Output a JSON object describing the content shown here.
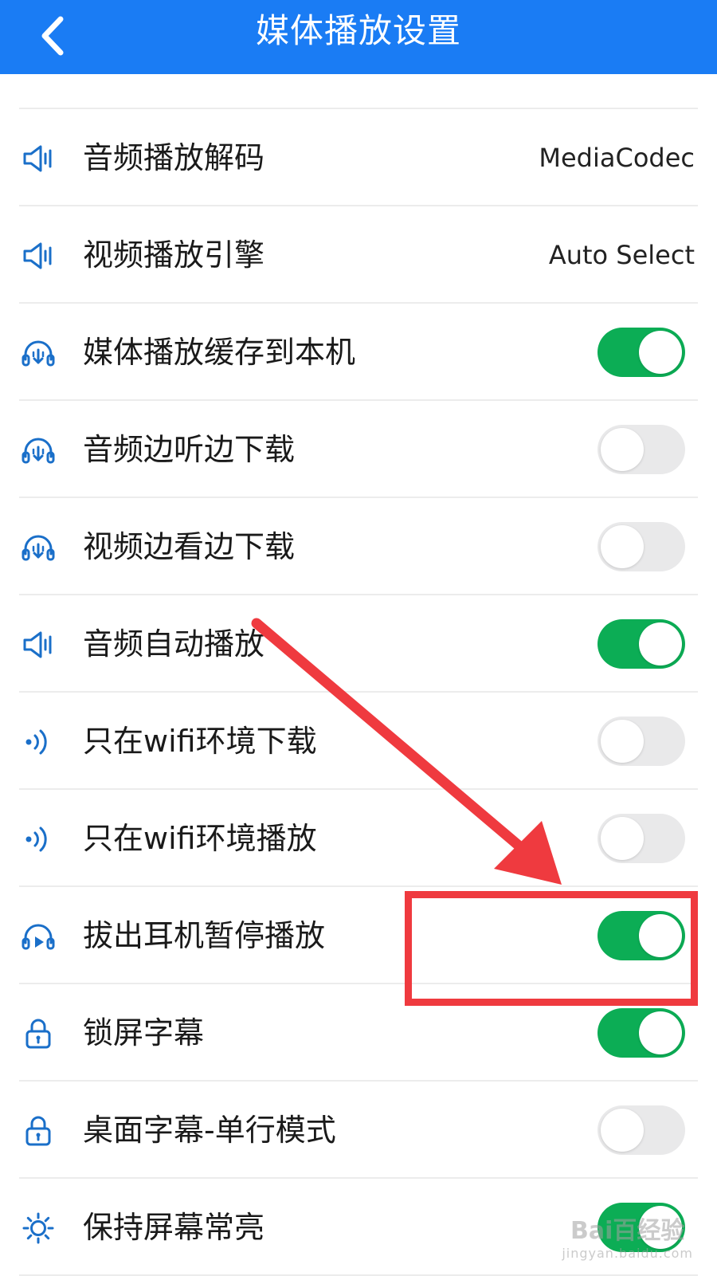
{
  "header": {
    "title": "媒体播放设置",
    "back_icon": "chevron-left-icon",
    "background_color": "#1a7cf4"
  },
  "settings": [
    {
      "label": "音频播放解码",
      "icon": "speaker-icon",
      "type": "value",
      "value": "MediaCodec"
    },
    {
      "label": "视频播放引擎",
      "icon": "speaker-icon",
      "type": "value",
      "value": "Auto Select"
    },
    {
      "label": "媒体播放缓存到本机",
      "icon": "headphones-download-icon",
      "type": "toggle",
      "on": true
    },
    {
      "label": "音频边听边下载",
      "icon": "headphones-download-icon",
      "type": "toggle",
      "on": false
    },
    {
      "label": "视频边看边下载",
      "icon": "headphones-download-icon",
      "type": "toggle",
      "on": false
    },
    {
      "label": "音频自动播放",
      "icon": "speaker-icon",
      "type": "toggle",
      "on": true
    },
    {
      "label": "只在wifi环境下载",
      "icon": "signal-waves-icon",
      "type": "toggle",
      "on": false
    },
    {
      "label": "只在wifi环境播放",
      "icon": "signal-waves-icon",
      "type": "toggle",
      "on": false
    },
    {
      "label": "拔出耳机暂停播放",
      "icon": "headphones-play-icon",
      "type": "toggle",
      "on": true
    },
    {
      "label": "锁屏字幕",
      "icon": "lock-icon",
      "type": "toggle",
      "on": true
    },
    {
      "label": "桌面字幕-单行模式",
      "icon": "lock-icon",
      "type": "toggle",
      "on": false
    },
    {
      "label": "保持屏幕常亮",
      "icon": "sun-icon",
      "type": "toggle",
      "on": true
    }
  ],
  "colors": {
    "toggle_on": "#0cad55",
    "toggle_off": "#e9e9ea",
    "icon": "#1a6fc9",
    "annotation": "#ef3a3f"
  },
  "watermark": {
    "brand": "Bai百经验",
    "url": "jingyan.baidu.com"
  }
}
